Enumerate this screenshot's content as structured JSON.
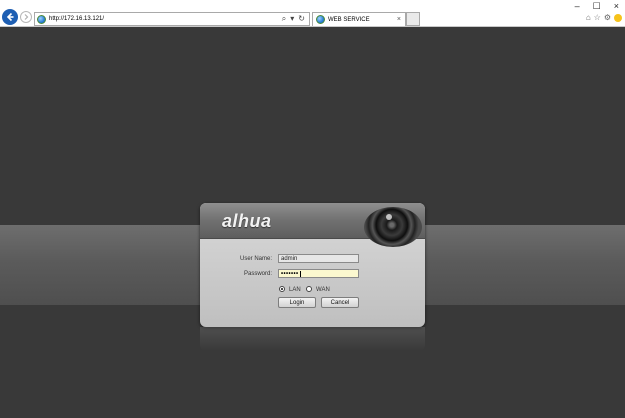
{
  "browser": {
    "url": "http://172.16.13.121/",
    "search_glyph": "⌕",
    "refresh_glyph": "↻",
    "tab_title": "WEB SERVICE",
    "tab_close": "×",
    "minimize_glyph": "–",
    "maximize_glyph": "☐",
    "close_glyph": "×",
    "home_glyph": "⌂",
    "star_glyph": "☆",
    "gear_glyph": "⚙"
  },
  "login": {
    "logo": "alhua",
    "username_label": "User Name:",
    "username_value": "admin",
    "password_label": "Password:",
    "password_value": "•••••••",
    "lan_label": "LAN",
    "wan_label": "WAN",
    "selected_network": "LAN",
    "login_button": "Login",
    "cancel_button": "Cancel"
  },
  "colors": {
    "accent": "#1e5fb3",
    "password_bg": "#fbf8cf"
  }
}
